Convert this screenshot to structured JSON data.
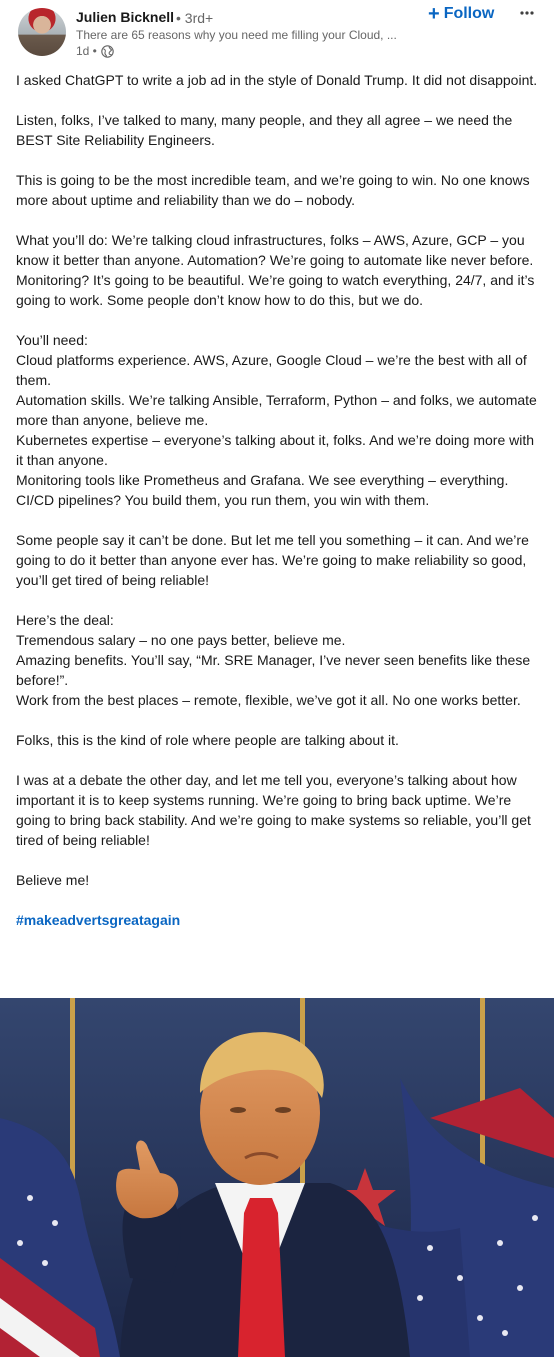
{
  "author": {
    "name": "Julien Bicknell",
    "degree": "• 3rd+",
    "headline": "There are 65 reasons why you need me filling your Cloud, ...",
    "time": "1d •",
    "visibility_icon": "globe-icon"
  },
  "actions": {
    "follow_label": "Follow",
    "follow_icon": "plus-icon",
    "more_icon": "more-options-icon",
    "accent_color": "#0a66c2"
  },
  "post": {
    "paragraphs": [
      "I asked ChatGPT to write a job ad in the style of Donald Trump. It did not disappoint.",
      "Listen, folks, I’ve talked to many, many people, and they all agree – we need the BEST Site Reliability Engineers.",
      "This is going to be the most incredible team, and we’re going to win. No one knows more about uptime and reliability than we do – nobody.",
      "What you’ll do: We’re talking cloud infrastructures, folks – AWS, Azure, GCP – you know it better than anyone. Automation? We’re going to automate like never before. Monitoring? It’s going to be beautiful. We’re going to watch everything, 24/7, and it’s going to work. Some people don’t know how to do this, but we do.",
      "You’ll need:\nCloud platforms experience. AWS, Azure, Google Cloud – we’re the best with all of them.\nAutomation skills. We’re talking Ansible, Terraform, Python – and folks, we automate more than anyone, believe me.\nKubernetes expertise – everyone’s talking about it, folks. And we’re doing more with it than anyone.\nMonitoring tools like Prometheus and Grafana. We see everything – everything.\nCI/CD pipelines? You build them, you run them, you win with them.",
      "Some people say it can’t be done. But let me tell you something – it can. And we’re going to do it better than anyone ever has. We’re going to make reliability so good, you’ll get tired of being reliable!",
      "Here’s the deal:\nTremendous salary – no one pays better, believe me.\nAmazing benefits. You’ll say, “Mr. SRE Manager, I’ve never seen benefits like these before!”.\nWork from the best places – remote, flexible, we’ve got it all. No one works better.",
      "Folks, this is the kind of role where people are talking about it.",
      "I was at a debate the other day, and let me tell you, everyone’s talking about how important it is to keep systems running. We’re going to bring back uptime. We’re going to bring back stability. And we’re going to make systems so reliable, you’ll get tired of being reliable!",
      "Believe me!"
    ],
    "hashtag": "#makeadvertsgreatagain"
  },
  "image": {
    "subject": "photo-man-pointing-flags-background"
  }
}
